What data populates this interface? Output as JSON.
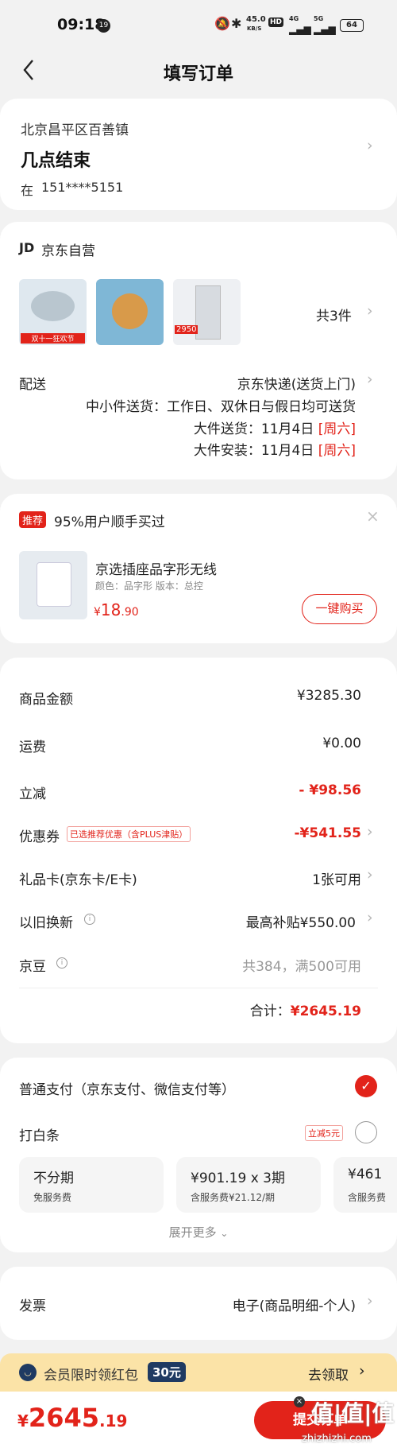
{
  "status_bar": {
    "time": "09:18",
    "notif_count": "19",
    "net_speed": "45.0",
    "net_unit": "KB/S",
    "hd": "HD",
    "net_4g": "4G",
    "net_5g": "5G",
    "battery": "64"
  },
  "nav": {
    "title": "填写订单"
  },
  "address": {
    "region": "北京昌平区百善镇",
    "detail": "几点结束",
    "name": "在",
    "phone": "151****5151"
  },
  "store": {
    "logo": "JD",
    "name": "京东自营",
    "count_text": "共3件",
    "thumb1_label": "双十一狂欢节",
    "thumb3_price": "2950",
    "delivery_label": "配送",
    "delivery_method": "京东快递(送货上门)",
    "small_items": "中小件送货：工作日、双休日与假日均可送货",
    "large_delivery_label": "大件送货：",
    "large_delivery_date": "11月4日",
    "large_delivery_day": "[周六]",
    "install_label": "大件安装：",
    "install_date": "11月4日",
    "install_day": "[周六]"
  },
  "recommend": {
    "tag": "推荐",
    "title": "95%用户顺手买过",
    "close": "×",
    "product_name": "京选插座品字形无线",
    "product_spec": "颜色：品字形 版本：总控",
    "price_symbol": "¥",
    "price_int": "18",
    "price_dec": ".90",
    "buy_button": "一键购买"
  },
  "summary": {
    "goods_label": "商品金额",
    "goods_value": "¥3285.30",
    "shipping_label": "运费",
    "shipping_value": "¥0.00",
    "discount_label": "立减",
    "discount_value": "- ¥98.56",
    "coupon_label": "优惠券",
    "coupon_tag": "已选推荐优惠（含PLUS津贴）",
    "coupon_value": "-¥541.55",
    "giftcard_label": "礼品卡(京东卡/E卡)",
    "giftcard_value": "1张可用",
    "tradein_label": "以旧换新",
    "tradein_value": "最高补贴¥550.00",
    "jingdou_label": "京豆",
    "jingdou_value": "共384，满500可用",
    "total_label": "合计：",
    "total_value": "¥2645.19"
  },
  "payment": {
    "normal_label": "普通支付（京东支付、微信支付等）",
    "baitiao_label": "打白条",
    "baitiao_promo": "立减5元",
    "plans": [
      {
        "title": "不分期",
        "sub": "免服务费"
      },
      {
        "title": "¥901.19 x 3期",
        "sub": "含服务费¥21.12/期"
      },
      {
        "title": "¥461",
        "sub": "含服务费"
      }
    ],
    "expand": "展开更多"
  },
  "invoice": {
    "label": "发票",
    "value": "电子(商品明细-个人)"
  },
  "promo": {
    "text": "会员限时领红包",
    "amount": "30元",
    "action": "去领取"
  },
  "bottom": {
    "total_int": "2645",
    "total_dec": ".19",
    "total_symbol": "¥",
    "submit": "提交订单",
    "watermark": "值|值|值",
    "watermark_url": "zhizhizhi.com"
  },
  "colors": {
    "accent": "#e2231a",
    "promo_bg": "#fbe3a7",
    "page_bg": "#f2f2f2"
  }
}
